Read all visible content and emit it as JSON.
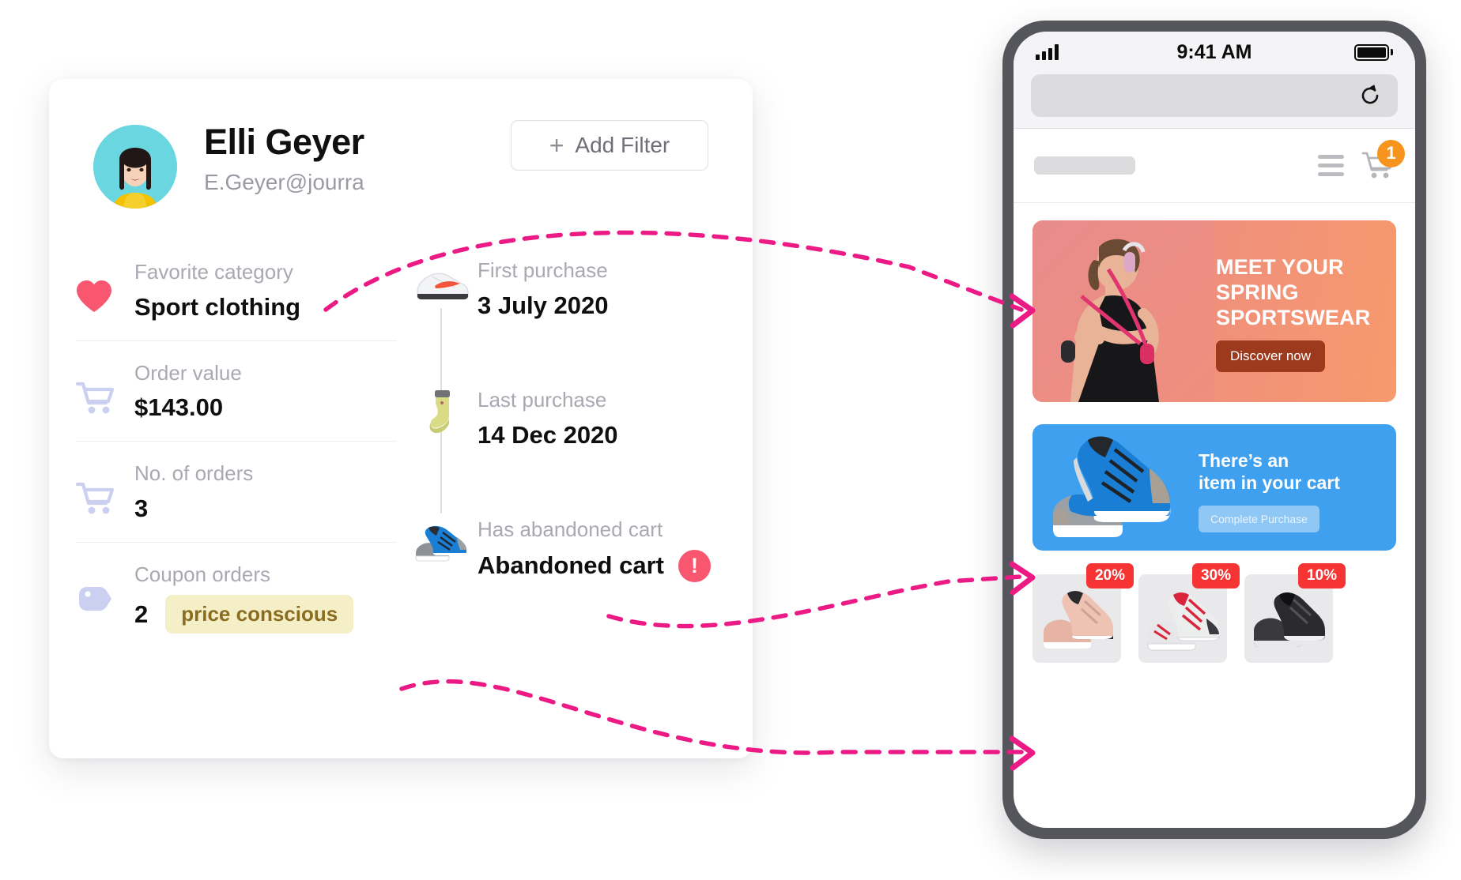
{
  "profile": {
    "name": "Elli Geyer",
    "email": "E.Geyer@jourra",
    "add_filter_label": "Add Filter",
    "add_filter_plus": "+",
    "stats_left": [
      {
        "label": "Favorite category",
        "value": "Sport clothing",
        "icon": "heart-icon"
      },
      {
        "label": "Order value",
        "value": "$143.00",
        "icon": "cart-icon"
      },
      {
        "label": "No. of orders",
        "value": "3",
        "icon": "cart-icon"
      },
      {
        "label": "Coupon orders",
        "value": "2",
        "badge": "price conscious",
        "icon": "tag-icon"
      }
    ],
    "stats_right": [
      {
        "label": "First purchase",
        "value": "3 July 2020",
        "icon": "sneaker-white-icon"
      },
      {
        "label": "Last purchase",
        "value": "14 Dec 2020",
        "icon": "sock-icon"
      },
      {
        "label": "Has abandoned cart",
        "value": "Abandoned cart",
        "alert": "!",
        "icon": "sneaker-blue-icon"
      }
    ]
  },
  "phone": {
    "status": {
      "time": "9:41 AM"
    },
    "header": {
      "cart_badge": "1"
    },
    "hero_banner": {
      "line1": "MEET YOUR",
      "line2": "SPRING",
      "line3": "SPORTSWEAR",
      "cta": "Discover now"
    },
    "cart_banner": {
      "line1": "There’s an",
      "line2": "item in your cart",
      "cta": "Complete Purchase"
    },
    "products": [
      {
        "discount": "20%"
      },
      {
        "discount": "30%"
      },
      {
        "discount": "10%"
      }
    ]
  },
  "colors": {
    "accent_magenta": "#EC1A84",
    "heart_red": "#F9566F",
    "badge_orange": "#F7941E",
    "discount_red": "#F73434",
    "banner_blue": "#3FA0EF",
    "avatar_teal": "#6AD6E0",
    "pill_yellow": "#F4EFC7",
    "pill_text": "#8A6D20"
  }
}
